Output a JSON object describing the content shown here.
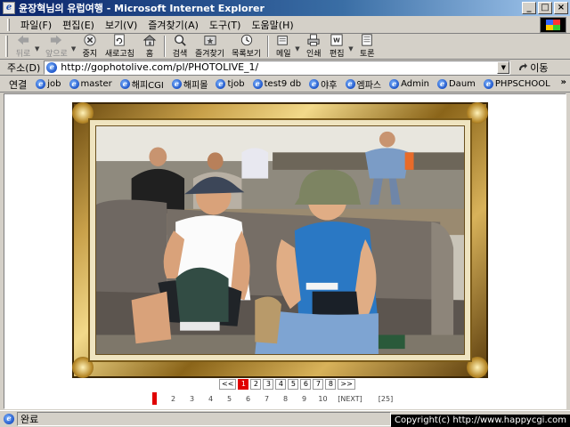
{
  "window": {
    "title": "윤장혁님의 유럽여행 - Microsoft Internet Explorer",
    "buttons": {
      "minimize": "_",
      "maximize": "□",
      "close": "×"
    }
  },
  "menu": [
    "파일(F)",
    "편집(E)",
    "보기(V)",
    "즐겨찾기(A)",
    "도구(T)",
    "도움말(H)"
  ],
  "toolbar": [
    {
      "id": "back",
      "label": "뒤로",
      "icon": "back-arrow-icon",
      "disabled": true,
      "dropdown": true
    },
    {
      "id": "forward",
      "label": "앞으로",
      "icon": "forward-arrow-icon",
      "disabled": true,
      "dropdown": true
    },
    {
      "id": "stop",
      "label": "중지",
      "icon": "stop-icon"
    },
    {
      "id": "refresh",
      "label": "새로고침",
      "icon": "refresh-icon"
    },
    {
      "id": "home",
      "label": "홈",
      "icon": "home-icon"
    },
    {
      "id": "search",
      "label": "검색",
      "icon": "search-icon",
      "sepBefore": true
    },
    {
      "id": "favorites",
      "label": "즐겨찾기",
      "icon": "favorites-icon"
    },
    {
      "id": "history",
      "label": "목록보기",
      "icon": "history-icon"
    },
    {
      "id": "mail",
      "label": "메일",
      "icon": "mail-icon",
      "sepBefore": true,
      "dropdown": true
    },
    {
      "id": "print",
      "label": "인쇄",
      "icon": "print-icon"
    },
    {
      "id": "edit",
      "label": "편집",
      "icon": "edit-icon",
      "dropdown": true
    },
    {
      "id": "discuss",
      "label": "토론",
      "icon": "discuss-icon"
    }
  ],
  "address": {
    "label": "주소(D)",
    "url": "http://gophotolive.com/pl/PHOTOLIVE_1/",
    "go_label": "이동"
  },
  "links": {
    "label": "연결",
    "items": [
      "job",
      "master",
      "해피CGI",
      "해피몰",
      "tjob",
      "test9 db",
      "야후",
      "엠파스",
      "Admin",
      "Daum",
      "PHPSCHOOL"
    ],
    "more": "»"
  },
  "pager": {
    "prev": "<<",
    "pages": [
      "1",
      "2",
      "3",
      "4",
      "5",
      "6",
      "7",
      "8"
    ],
    "active_page": "1",
    "next": ">>"
  },
  "thumbnav": {
    "numbers": [
      "2",
      "3",
      "4",
      "5",
      "6",
      "7",
      "8",
      "9",
      "10"
    ],
    "next": "[NEXT]",
    "total": "[25]"
  },
  "status": {
    "text": "완료",
    "copyright": "Copyright(c) http://www.happycgi.com"
  }
}
